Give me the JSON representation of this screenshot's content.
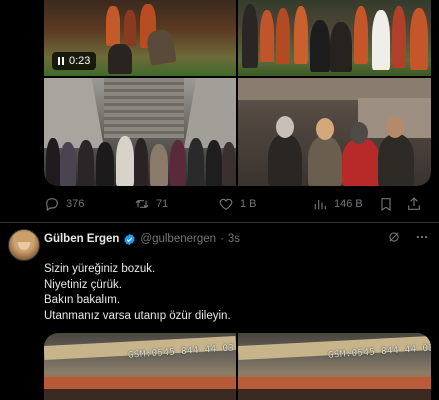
{
  "tweet1": {
    "video_duration": "0:23",
    "actions": {
      "replies": "376",
      "reposts": "71",
      "likes": "1 B",
      "views": "146 B"
    }
  },
  "tweet2": {
    "author_name": "Gülben Ergen",
    "author_handle": "@gulbenergen",
    "separator": "·",
    "time": "3s",
    "lines": [
      "Sizin yüreğiniz bozuk.",
      "Niyetiniz çürük.",
      "Bakın bakalım.",
      "Utanmanız varsa utanıp özür dileyin."
    ],
    "media_watermark": "GSM:0545 844 44 03"
  },
  "icons": {
    "reply": "reply-icon",
    "repost": "repost-icon",
    "like": "heart-icon",
    "views": "views-chart-icon",
    "bookmark": "bookmark-icon",
    "share": "share-icon",
    "verified": "verified-badge-icon",
    "grok": "grok-icon",
    "more": "more-icon"
  },
  "colors": {
    "background": "#000000",
    "text": "#e7e9ea",
    "secondary": "#71767b",
    "divider": "#2f3336",
    "verified": "#1d9bf0"
  }
}
